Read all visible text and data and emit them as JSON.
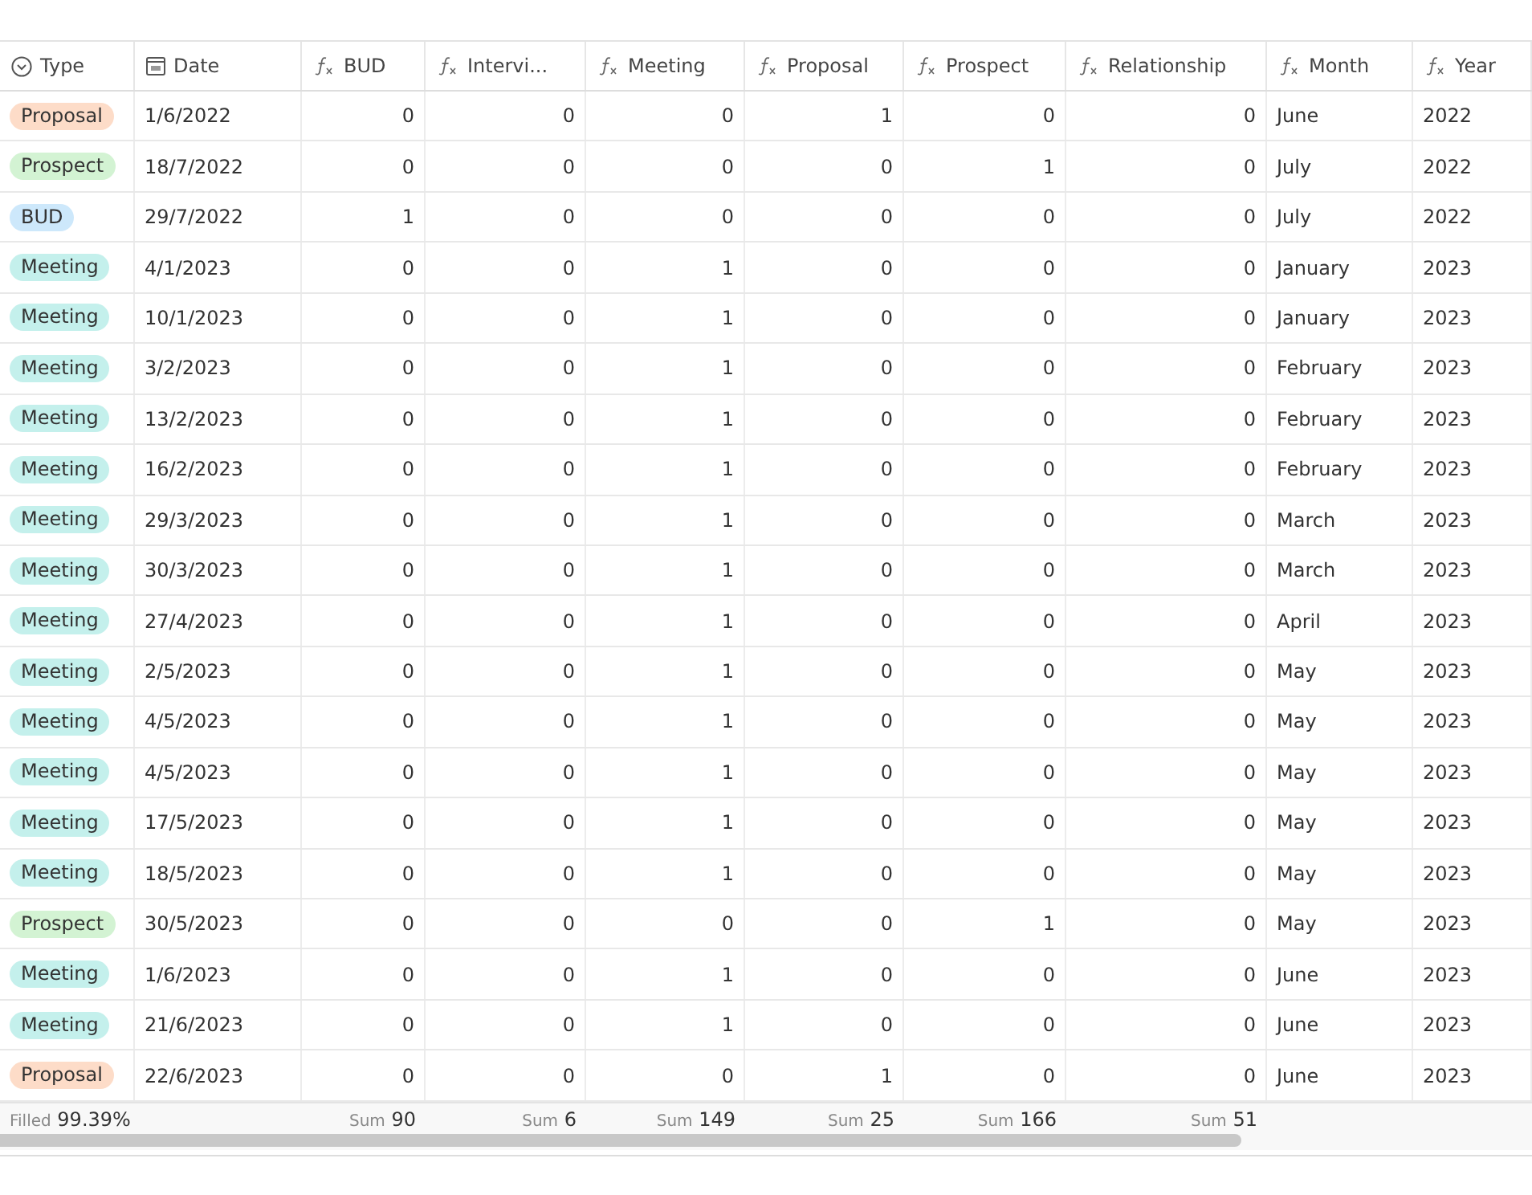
{
  "table": {
    "columns": [
      {
        "label": "Type",
        "kind": "select",
        "summary": {
          "label": "Filled",
          "value": "99.39%"
        }
      },
      {
        "label": "Date",
        "kind": "date"
      },
      {
        "label": "BUD",
        "kind": "number",
        "summary": {
          "label": "Sum",
          "value": "90"
        }
      },
      {
        "label": "Intervi...",
        "kind": "number",
        "summary": {
          "label": "Sum",
          "value": "6"
        }
      },
      {
        "label": "Meeting",
        "kind": "number",
        "summary": {
          "label": "Sum",
          "value": "149"
        }
      },
      {
        "label": "Proposal",
        "kind": "number",
        "summary": {
          "label": "Sum",
          "value": "25"
        }
      },
      {
        "label": "Prospect",
        "kind": "number",
        "summary": {
          "label": "Sum",
          "value": "166"
        }
      },
      {
        "label": "Relationship",
        "kind": "number",
        "summary": {
          "label": "Sum",
          "value": "51"
        }
      },
      {
        "label": "Month",
        "kind": "text"
      },
      {
        "label": "Year",
        "kind": "text"
      }
    ],
    "rows": [
      {
        "type": {
          "label": "Proposal",
          "color": "#fddcc8"
        },
        "date": "1/6/2022",
        "bud": "0",
        "intervi": "0",
        "meeting": "0",
        "proposal": "1",
        "prospect": "0",
        "relationship": "0",
        "month": "June",
        "year": "2022"
      },
      {
        "type": {
          "label": "Prospect",
          "color": "#d3f3d3"
        },
        "date": "18/7/2022",
        "bud": "0",
        "intervi": "0",
        "meeting": "0",
        "proposal": "0",
        "prospect": "1",
        "relationship": "0",
        "month": "July",
        "year": "2022"
      },
      {
        "type": {
          "label": "BUD",
          "color": "#cde8fb"
        },
        "date": "29/7/2022",
        "bud": "1",
        "intervi": "0",
        "meeting": "0",
        "proposal": "0",
        "prospect": "0",
        "relationship": "0",
        "month": "July",
        "year": "2022"
      },
      {
        "type": {
          "label": "Meeting",
          "color": "#c4f0ec"
        },
        "date": "4/1/2023",
        "bud": "0",
        "intervi": "0",
        "meeting": "1",
        "proposal": "0",
        "prospect": "0",
        "relationship": "0",
        "month": "January",
        "year": "2023"
      },
      {
        "type": {
          "label": "Meeting",
          "color": "#c4f0ec"
        },
        "date": "10/1/2023",
        "bud": "0",
        "intervi": "0",
        "meeting": "1",
        "proposal": "0",
        "prospect": "0",
        "relationship": "0",
        "month": "January",
        "year": "2023"
      },
      {
        "type": {
          "label": "Meeting",
          "color": "#c4f0ec"
        },
        "date": "3/2/2023",
        "bud": "0",
        "intervi": "0",
        "meeting": "1",
        "proposal": "0",
        "prospect": "0",
        "relationship": "0",
        "month": "February",
        "year": "2023"
      },
      {
        "type": {
          "label": "Meeting",
          "color": "#c4f0ec"
        },
        "date": "13/2/2023",
        "bud": "0",
        "intervi": "0",
        "meeting": "1",
        "proposal": "0",
        "prospect": "0",
        "relationship": "0",
        "month": "February",
        "year": "2023"
      },
      {
        "type": {
          "label": "Meeting",
          "color": "#c4f0ec"
        },
        "date": "16/2/2023",
        "bud": "0",
        "intervi": "0",
        "meeting": "1",
        "proposal": "0",
        "prospect": "0",
        "relationship": "0",
        "month": "February",
        "year": "2023"
      },
      {
        "type": {
          "label": "Meeting",
          "color": "#c4f0ec"
        },
        "date": "29/3/2023",
        "bud": "0",
        "intervi": "0",
        "meeting": "1",
        "proposal": "0",
        "prospect": "0",
        "relationship": "0",
        "month": "March",
        "year": "2023"
      },
      {
        "type": {
          "label": "Meeting",
          "color": "#c4f0ec"
        },
        "date": "30/3/2023",
        "bud": "0",
        "intervi": "0",
        "meeting": "1",
        "proposal": "0",
        "prospect": "0",
        "relationship": "0",
        "month": "March",
        "year": "2023"
      },
      {
        "type": {
          "label": "Meeting",
          "color": "#c4f0ec"
        },
        "date": "27/4/2023",
        "bud": "0",
        "intervi": "0",
        "meeting": "1",
        "proposal": "0",
        "prospect": "0",
        "relationship": "0",
        "month": "April",
        "year": "2023"
      },
      {
        "type": {
          "label": "Meeting",
          "color": "#c4f0ec"
        },
        "date": "2/5/2023",
        "bud": "0",
        "intervi": "0",
        "meeting": "1",
        "proposal": "0",
        "prospect": "0",
        "relationship": "0",
        "month": "May",
        "year": "2023"
      },
      {
        "type": {
          "label": "Meeting",
          "color": "#c4f0ec"
        },
        "date": "4/5/2023",
        "bud": "0",
        "intervi": "0",
        "meeting": "1",
        "proposal": "0",
        "prospect": "0",
        "relationship": "0",
        "month": "May",
        "year": "2023"
      },
      {
        "type": {
          "label": "Meeting",
          "color": "#c4f0ec"
        },
        "date": "4/5/2023",
        "bud": "0",
        "intervi": "0",
        "meeting": "1",
        "proposal": "0",
        "prospect": "0",
        "relationship": "0",
        "month": "May",
        "year": "2023"
      },
      {
        "type": {
          "label": "Meeting",
          "color": "#c4f0ec"
        },
        "date": "17/5/2023",
        "bud": "0",
        "intervi": "0",
        "meeting": "1",
        "proposal": "0",
        "prospect": "0",
        "relationship": "0",
        "month": "May",
        "year": "2023"
      },
      {
        "type": {
          "label": "Meeting",
          "color": "#c4f0ec"
        },
        "date": "18/5/2023",
        "bud": "0",
        "intervi": "0",
        "meeting": "1",
        "proposal": "0",
        "prospect": "0",
        "relationship": "0",
        "month": "May",
        "year": "2023"
      },
      {
        "type": {
          "label": "Prospect",
          "color": "#d3f3d3"
        },
        "date": "30/5/2023",
        "bud": "0",
        "intervi": "0",
        "meeting": "0",
        "proposal": "0",
        "prospect": "1",
        "relationship": "0",
        "month": "May",
        "year": "2023"
      },
      {
        "type": {
          "label": "Meeting",
          "color": "#c4f0ec"
        },
        "date": "1/6/2023",
        "bud": "0",
        "intervi": "0",
        "meeting": "1",
        "proposal": "0",
        "prospect": "0",
        "relationship": "0",
        "month": "June",
        "year": "2023"
      },
      {
        "type": {
          "label": "Meeting",
          "color": "#c4f0ec"
        },
        "date": "21/6/2023",
        "bud": "0",
        "intervi": "0",
        "meeting": "1",
        "proposal": "0",
        "prospect": "0",
        "relationship": "0",
        "month": "June",
        "year": "2023"
      },
      {
        "type": {
          "label": "Proposal",
          "color": "#fddcc8"
        },
        "date": "22/6/2023",
        "bud": "0",
        "intervi": "0",
        "meeting": "0",
        "proposal": "1",
        "prospect": "0",
        "relationship": "0",
        "month": "June",
        "year": "2023"
      }
    ]
  }
}
